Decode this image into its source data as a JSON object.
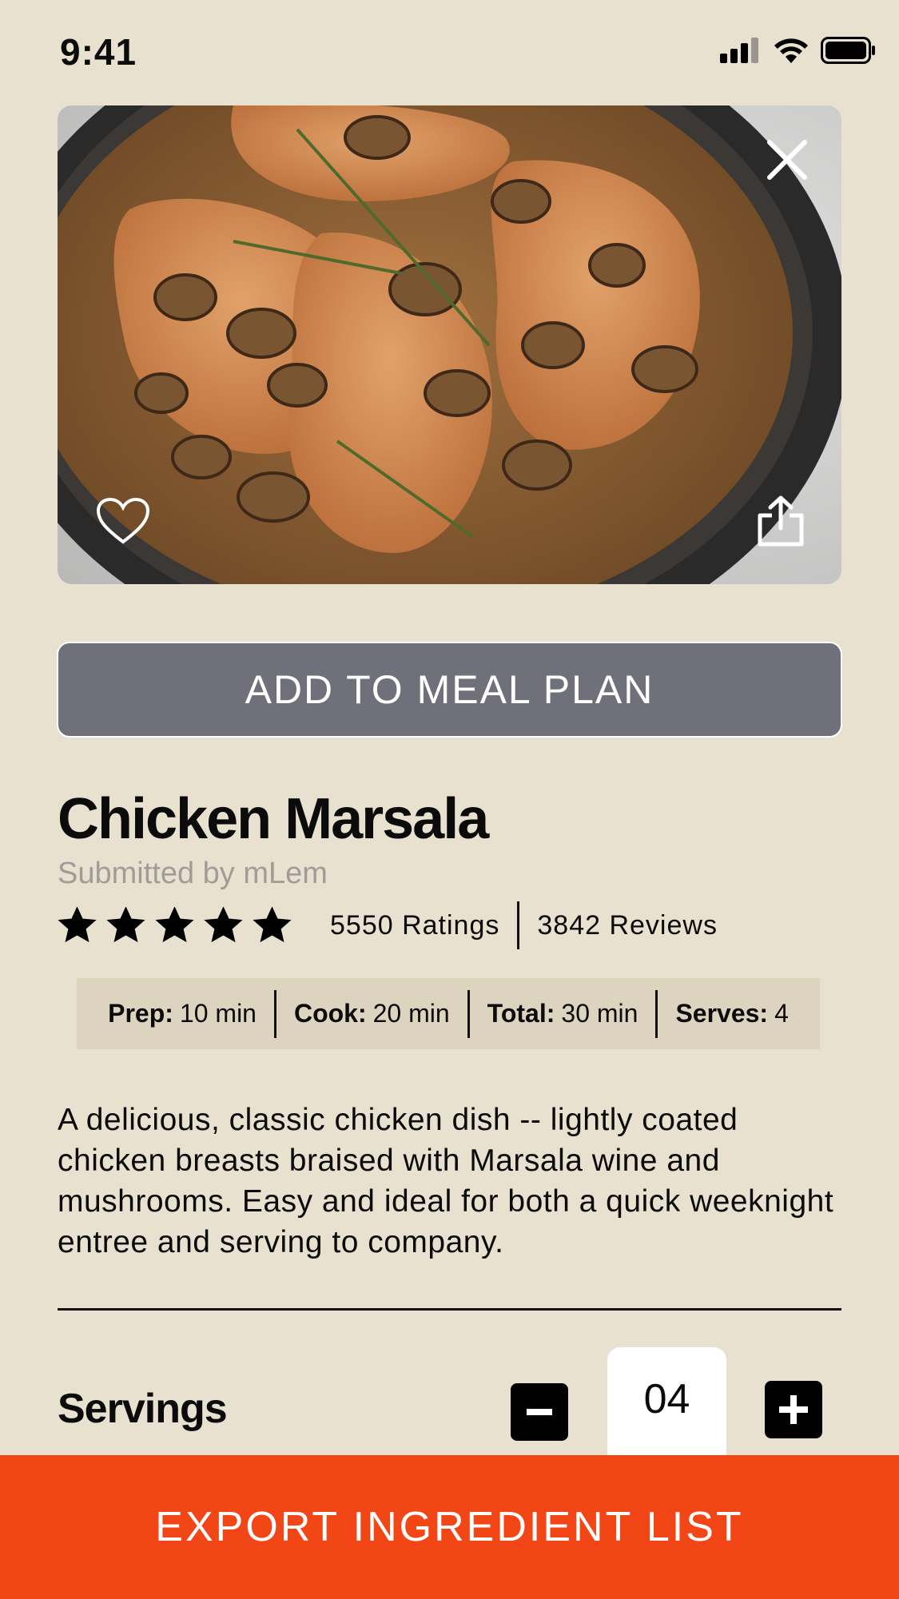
{
  "status_bar": {
    "time": "9:41",
    "icons": [
      "cellular-signal-icon",
      "wifi-icon",
      "battery-icon"
    ]
  },
  "hero": {
    "icons": [
      "close-icon",
      "heart-icon",
      "share-icon"
    ]
  },
  "actions": {
    "add_to_meal_plan": "ADD TO MEAL PLAN",
    "export_ingredient_list": "EXPORT INGREDIENT LIST"
  },
  "recipe": {
    "title": "Chicken Marsala",
    "submitted_by": "Submitted by mLem",
    "rating_stars": 5,
    "ratings_text": "5550 Ratings",
    "reviews_text": "3842 Reviews",
    "stats": [
      {
        "label": "Prep:",
        "value": "10 min"
      },
      {
        "label": "Cook:",
        "value": "20 min"
      },
      {
        "label": "Total:",
        "value": "30 min"
      },
      {
        "label": "Serves:",
        "value": "4"
      }
    ],
    "description": "A delicious, classic chicken dish -- lightly coated chicken breasts braised with Marsala wine and mushrooms. Easy and ideal for both a quick weeknight entree and serving to company."
  },
  "servings": {
    "label": "Servings",
    "value": "04",
    "icons": [
      "minus-icon",
      "plus-icon"
    ]
  },
  "colors": {
    "background": "#e9e1cf",
    "meal_button": "#6f707a",
    "export_button": "#f34616",
    "stats_box": "#ddd4c0",
    "muted_text": "#a09c97"
  }
}
